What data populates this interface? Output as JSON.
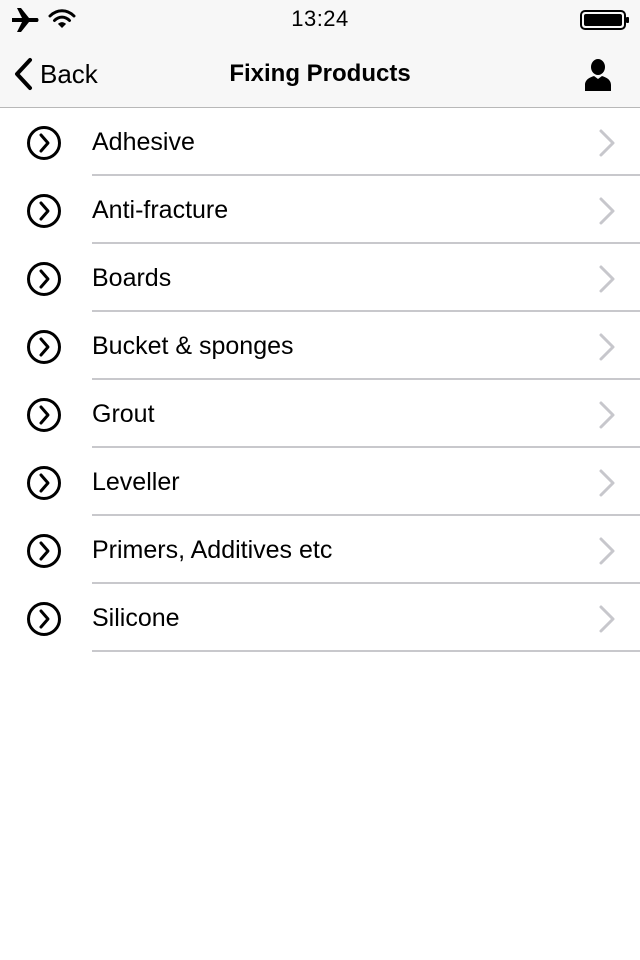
{
  "status_bar": {
    "time": "13:24",
    "icons": [
      "airplane-icon",
      "wifi-icon",
      "battery-icon"
    ]
  },
  "nav": {
    "back_label": "Back",
    "title": "Fixing Products",
    "right_icon": "person-icon"
  },
  "list": {
    "items": [
      {
        "label": "Adhesive"
      },
      {
        "label": "Anti-fracture"
      },
      {
        "label": "Boards"
      },
      {
        "label": "Bucket & sponges"
      },
      {
        "label": "Grout"
      },
      {
        "label": "Leveller"
      },
      {
        "label": "Primers, Additives etc"
      },
      {
        "label": "Silicone"
      }
    ]
  },
  "colors": {
    "nav_background": "#f7f7f7",
    "divider": "#c8c8cc",
    "disclosure": "#c7c7cc",
    "text": "#000000"
  }
}
